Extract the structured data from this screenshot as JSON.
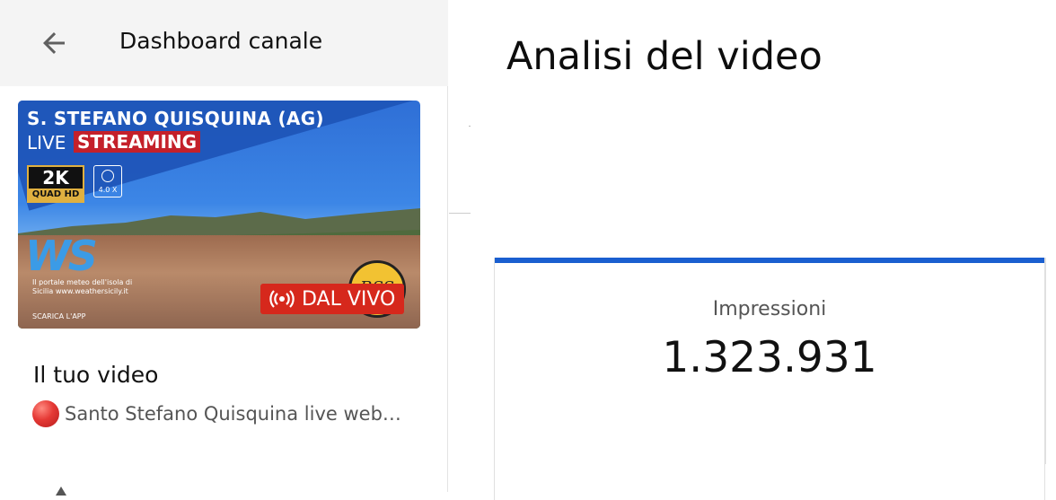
{
  "header": {
    "title": "Dashboard canale",
    "back_icon": "arrow-left-icon"
  },
  "thumbnail": {
    "headline": "S. STEFANO QUISQUINA (AG)",
    "live_word": "LIVE",
    "streaming_word": "STREAMING",
    "quality_big": "2K",
    "quality_small": "QUAD HD",
    "zoom_label": "4.0 X",
    "logo_text": "WS",
    "logo_sub": "Il portale meteo dell'isola di Sicilia www.weathersicily.it",
    "app_text": "SCARICA L'APP",
    "rss_text": "RSS",
    "live_badge": "DAL VIVO",
    "colors": {
      "live_red": "#d6281c",
      "sky": "#2f6fd6"
    }
  },
  "your_video": {
    "heading": "Il tuo video",
    "title": "Santo Stefano Quisquina live webcam"
  },
  "main": {
    "title": "Analisi del video",
    "metric": {
      "label": "Impressioni",
      "value": "1.323.931",
      "accent": "#1a5fd0"
    }
  }
}
